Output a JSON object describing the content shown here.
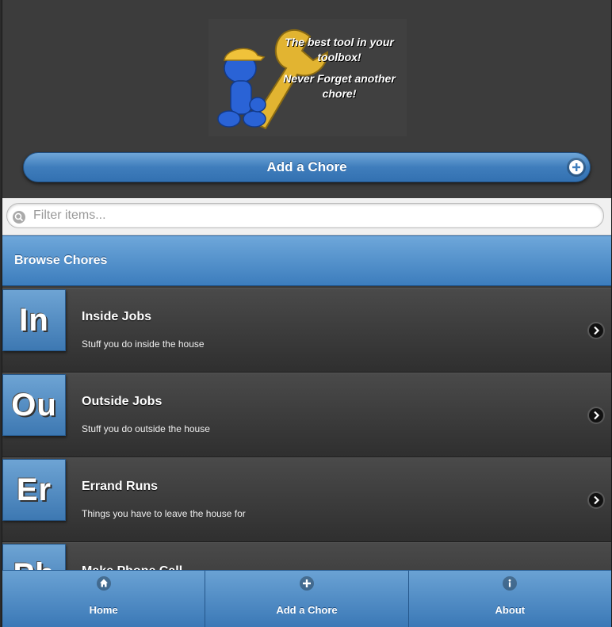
{
  "header": {
    "banner_line1": "The best tool in your toolbox!",
    "banner_line2": "Never Forget another chore!",
    "add_chore_button": "Add a Chore"
  },
  "filter": {
    "placeholder": "Filter items..."
  },
  "list": {
    "divider": "Browse Chores",
    "items": [
      {
        "thumb": "In",
        "title": "Inside Jobs",
        "desc": "Stuff you do inside the house"
      },
      {
        "thumb": "Ou",
        "title": "Outside Jobs",
        "desc": "Stuff you do outside the house"
      },
      {
        "thumb": "Er",
        "title": "Errand Runs",
        "desc": "Things you have to leave the house for"
      },
      {
        "thumb": "Ph",
        "title": "Make Phone Call",
        "desc": ""
      }
    ]
  },
  "navbar": {
    "items": [
      {
        "label": "Home",
        "icon": "home-icon"
      },
      {
        "label": "Add a Chore",
        "icon": "plus-icon"
      },
      {
        "label": "About",
        "icon": "info-icon"
      }
    ]
  },
  "colors": {
    "accent_blue": "#3f7dbc",
    "dark_bg": "#3a3a3a"
  }
}
